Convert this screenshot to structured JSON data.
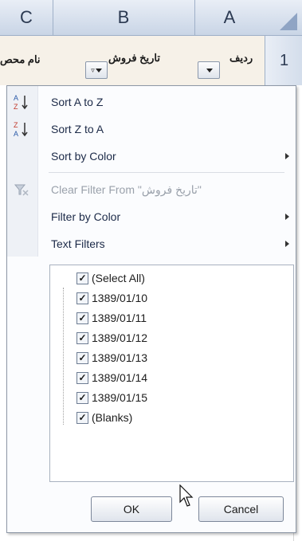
{
  "sheet": {
    "columns": [
      "C",
      "B",
      "A"
    ],
    "row_number": "1",
    "row1_cells": {
      "c": "نام محص",
      "b": "تاریخ فروش",
      "a": "ردیف"
    }
  },
  "filter_menu": {
    "items": [
      {
        "label": "Sort A to Z",
        "icon": "sort-ascending-icon"
      },
      {
        "label": "Sort Z to A",
        "icon": "sort-descending-icon"
      },
      {
        "label": "Sort by Color",
        "has_submenu": true
      },
      {
        "label": "Clear Filter From \"تاریخ فروش\"",
        "icon": "clear-filter-icon",
        "disabled": true
      },
      {
        "label": "Filter by Color",
        "has_submenu": true
      },
      {
        "label": "Text Filters",
        "has_submenu": true
      }
    ],
    "values": [
      {
        "label": "(Select All)",
        "checked": true
      },
      {
        "label": "1389/01/10",
        "checked": true
      },
      {
        "label": "1389/01/11",
        "checked": true
      },
      {
        "label": "1389/01/12",
        "checked": true
      },
      {
        "label": "1389/01/13",
        "checked": true
      },
      {
        "label": "1389/01/14",
        "checked": true
      },
      {
        "label": "1389/01/15",
        "checked": true
      },
      {
        "label": "(Blanks)",
        "checked": true
      }
    ],
    "ok_label": "OK",
    "cancel_label": "Cancel"
  },
  "colors": {
    "header_bg": "#c9d5e6",
    "menu_text": "#1c2a48",
    "disabled_text": "#9aa1ab"
  }
}
